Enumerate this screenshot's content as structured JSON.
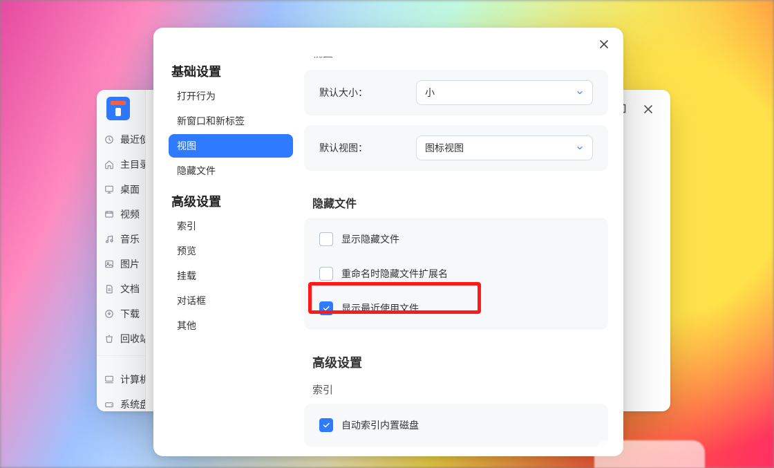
{
  "bg_window": {
    "sidebar_items": [
      {
        "icon": "clock",
        "label": "最近使用"
      },
      {
        "icon": "home",
        "label": "主目录"
      },
      {
        "icon": "desktop",
        "label": "桌面"
      },
      {
        "icon": "video",
        "label": "视频"
      },
      {
        "icon": "music",
        "label": "音乐"
      },
      {
        "icon": "picture",
        "label": "图片"
      },
      {
        "icon": "document",
        "label": "文档"
      },
      {
        "icon": "download",
        "label": "下载"
      },
      {
        "icon": "trash",
        "label": "回收站"
      }
    ],
    "sidebar_items2": [
      {
        "icon": "computer",
        "label": "计算机"
      },
      {
        "icon": "disk",
        "label": "系统盘"
      }
    ]
  },
  "dialog": {
    "nav": [
      {
        "title": "基础设置",
        "items": [
          {
            "label": "打开行为",
            "active": false
          },
          {
            "label": "新窗口和新标签",
            "active": false
          },
          {
            "label": "视图",
            "active": true
          },
          {
            "label": "隐藏文件",
            "active": false
          }
        ]
      },
      {
        "title": "高级设置",
        "items": [
          {
            "label": "索引",
            "active": false
          },
          {
            "label": "预览",
            "active": false
          },
          {
            "label": "挂载",
            "active": false
          },
          {
            "label": "对话框",
            "active": false
          },
          {
            "label": "其他",
            "active": false
          }
        ]
      }
    ],
    "content": {
      "scrolled_heading": "视图",
      "size_row": {
        "label": "默认大小：",
        "value": "小"
      },
      "view_row": {
        "label": "默认视图：",
        "value": "图标视图"
      },
      "hidden_files_title": "隐藏文件",
      "hidden_files_options": [
        {
          "label": "显示隐藏文件",
          "checked": false
        },
        {
          "label": "重命名时隐藏文件扩展名",
          "checked": false,
          "highlighted": true
        },
        {
          "label": "显示最近使用文件",
          "checked": true
        }
      ],
      "advanced_title": "高级设置",
      "index_title": "索引",
      "index_options": [
        {
          "label": "自动索引内置磁盘",
          "checked": true
        }
      ]
    }
  }
}
